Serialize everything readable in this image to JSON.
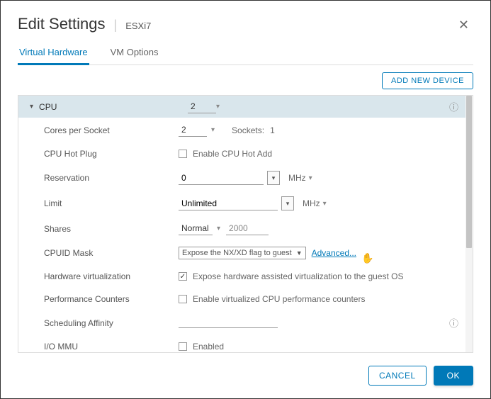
{
  "header": {
    "title": "Edit Settings",
    "vm_name": "ESXi7"
  },
  "tabs": {
    "hardware": "Virtual Hardware",
    "options": "VM Options"
  },
  "add_device": "ADD NEW DEVICE",
  "cpu_section": {
    "label": "CPU",
    "value": "2"
  },
  "rows": {
    "cores_per_socket": {
      "label": "Cores per Socket",
      "value": "2",
      "sockets_label": "Sockets:",
      "sockets_value": "1"
    },
    "hot_plug": {
      "label": "CPU Hot Plug",
      "checkbox_label": "Enable CPU Hot Add"
    },
    "reservation": {
      "label": "Reservation",
      "value": "0",
      "unit": "MHz"
    },
    "limit": {
      "label": "Limit",
      "value": "Unlimited",
      "unit": "MHz"
    },
    "shares": {
      "label": "Shares",
      "value": "Normal",
      "num": "2000"
    },
    "cpuid": {
      "label": "CPUID Mask",
      "select": "Expose the NX/XD flag to guest",
      "link": "Advanced..."
    },
    "hwvirt": {
      "label": "Hardware virtualization",
      "checkbox_label": "Expose hardware assisted virtualization to the guest OS",
      "checked": true
    },
    "perfctr": {
      "label": "Performance Counters",
      "checkbox_label": "Enable virtualized CPU performance counters"
    },
    "sched": {
      "label": "Scheduling Affinity"
    },
    "iommu": {
      "label": "I/O MMU",
      "checkbox_label": "Enabled"
    }
  },
  "footer": {
    "cancel": "CANCEL",
    "ok": "OK"
  }
}
